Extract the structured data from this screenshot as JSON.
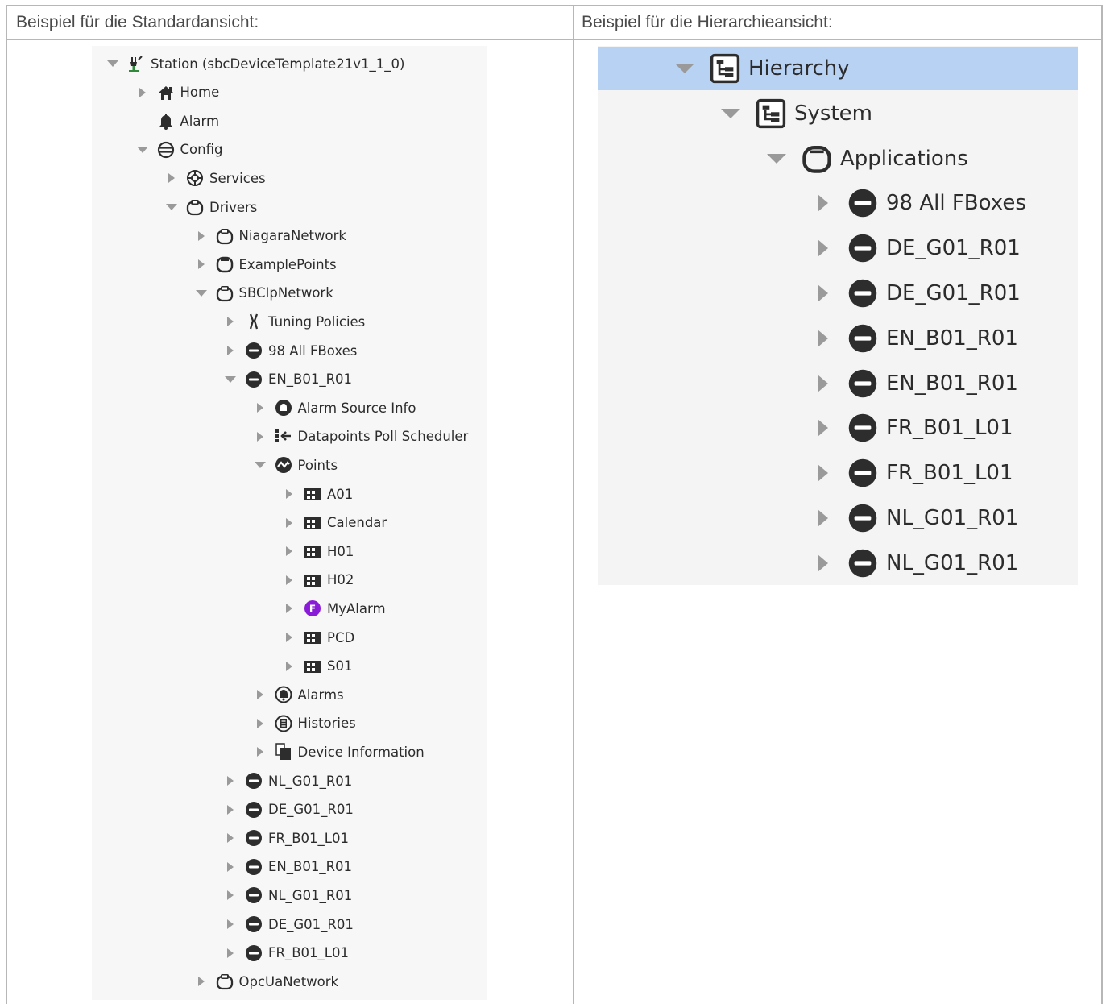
{
  "headers": {
    "left": "Beispiel für die Standardansicht:",
    "right": "Beispiel für die Hierarchieansicht:"
  },
  "left_tree": [
    {
      "label": "Station (sbcDeviceTemplate21v1_1_0)",
      "depth": 0,
      "toggle": "expanded",
      "icon": "station-icon"
    },
    {
      "label": "Home",
      "depth": 1,
      "toggle": "collapsed",
      "icon": "home-icon"
    },
    {
      "label": "Alarm",
      "depth": 1,
      "toggle": "none",
      "icon": "bell-icon"
    },
    {
      "label": "Config",
      "depth": 1,
      "toggle": "expanded",
      "icon": "database-icon"
    },
    {
      "label": "Services",
      "depth": 2,
      "toggle": "collapsed",
      "icon": "services-icon"
    },
    {
      "label": "Drivers",
      "depth": 2,
      "toggle": "expanded",
      "icon": "driver-icon"
    },
    {
      "label": "NiagaraNetwork",
      "depth": 3,
      "toggle": "collapsed",
      "icon": "driver-icon"
    },
    {
      "label": "ExamplePoints",
      "depth": 3,
      "toggle": "collapsed",
      "icon": "folder-icon"
    },
    {
      "label": "SBCIpNetwork",
      "depth": 3,
      "toggle": "expanded",
      "icon": "driver-icon"
    },
    {
      "label": "Tuning Policies",
      "depth": 4,
      "toggle": "collapsed",
      "icon": "tools-icon"
    },
    {
      "label": "98 All FBoxes",
      "depth": 4,
      "toggle": "collapsed",
      "icon": "device-icon"
    },
    {
      "label": "EN_B01_R01",
      "depth": 4,
      "toggle": "expanded",
      "icon": "device-icon"
    },
    {
      "label": "Alarm Source Info",
      "depth": 5,
      "toggle": "collapsed",
      "icon": "alarm-source-icon"
    },
    {
      "label": "Datapoints Poll Scheduler",
      "depth": 5,
      "toggle": "collapsed",
      "icon": "scheduler-icon"
    },
    {
      "label": "Points",
      "depth": 5,
      "toggle": "expanded",
      "icon": "points-icon"
    },
    {
      "label": "A01",
      "depth": 6,
      "toggle": "collapsed",
      "icon": "points-folder-icon"
    },
    {
      "label": "Calendar",
      "depth": 6,
      "toggle": "collapsed",
      "icon": "points-folder-icon"
    },
    {
      "label": "H01",
      "depth": 6,
      "toggle": "collapsed",
      "icon": "points-folder-icon"
    },
    {
      "label": "H02",
      "depth": 6,
      "toggle": "collapsed",
      "icon": "points-folder-icon"
    },
    {
      "label": "MyAlarm",
      "depth": 6,
      "toggle": "collapsed",
      "icon": "fbox-f-icon"
    },
    {
      "label": "PCD",
      "depth": 6,
      "toggle": "collapsed",
      "icon": "points-folder-icon"
    },
    {
      "label": "S01",
      "depth": 6,
      "toggle": "collapsed",
      "icon": "points-folder-icon"
    },
    {
      "label": "Alarms",
      "depth": 5,
      "toggle": "collapsed",
      "icon": "alarms-icon"
    },
    {
      "label": "Histories",
      "depth": 5,
      "toggle": "collapsed",
      "icon": "histories-icon"
    },
    {
      "label": "Device Information",
      "depth": 5,
      "toggle": "collapsed",
      "icon": "device-info-icon"
    },
    {
      "label": "NL_G01_R01",
      "depth": 4,
      "toggle": "collapsed",
      "icon": "device-icon"
    },
    {
      "label": "DE_G01_R01",
      "depth": 4,
      "toggle": "collapsed",
      "icon": "device-icon"
    },
    {
      "label": "FR_B01_L01",
      "depth": 4,
      "toggle": "collapsed",
      "icon": "device-icon"
    },
    {
      "label": "EN_B01_R01",
      "depth": 4,
      "toggle": "collapsed",
      "icon": "device-icon"
    },
    {
      "label": "NL_G01_R01",
      "depth": 4,
      "toggle": "collapsed",
      "icon": "device-icon"
    },
    {
      "label": "DE_G01_R01",
      "depth": 4,
      "toggle": "collapsed",
      "icon": "device-icon"
    },
    {
      "label": "FR_B01_L01",
      "depth": 4,
      "toggle": "collapsed",
      "icon": "device-icon"
    },
    {
      "label": "OpcUaNetwork",
      "depth": 3,
      "toggle": "collapsed",
      "icon": "driver-icon"
    }
  ],
  "right_tree": [
    {
      "label": "Hierarchy",
      "depth": 0,
      "toggle": "expanded",
      "icon": "hierarchy-icon",
      "selected": true
    },
    {
      "label": "System",
      "depth": 1,
      "toggle": "expanded",
      "icon": "hierarchy-icon"
    },
    {
      "label": "Applications",
      "depth": 2,
      "toggle": "expanded",
      "icon": "folder-icon"
    },
    {
      "label": "98 All FBoxes",
      "depth": 3,
      "toggle": "collapsed",
      "icon": "device-icon"
    },
    {
      "label": "DE_G01_R01",
      "depth": 3,
      "toggle": "collapsed",
      "icon": "device-icon"
    },
    {
      "label": "DE_G01_R01",
      "depth": 3,
      "toggle": "collapsed",
      "icon": "device-icon"
    },
    {
      "label": "EN_B01_R01",
      "depth": 3,
      "toggle": "collapsed",
      "icon": "device-icon"
    },
    {
      "label": "EN_B01_R01",
      "depth": 3,
      "toggle": "collapsed",
      "icon": "device-icon"
    },
    {
      "label": "FR_B01_L01",
      "depth": 3,
      "toggle": "collapsed",
      "icon": "device-icon"
    },
    {
      "label": "FR_B01_L01",
      "depth": 3,
      "toggle": "collapsed",
      "icon": "device-icon"
    },
    {
      "label": "NL_G01_R01",
      "depth": 3,
      "toggle": "collapsed",
      "icon": "device-icon"
    },
    {
      "label": "NL_G01_R01",
      "depth": 3,
      "toggle": "collapsed",
      "icon": "device-icon"
    }
  ],
  "colors": {
    "selection": "#b8d2f4",
    "fbox_purple": "#8a1bd6",
    "icon_dark": "#2d2d2d",
    "station_green": "#2f8a3a"
  }
}
